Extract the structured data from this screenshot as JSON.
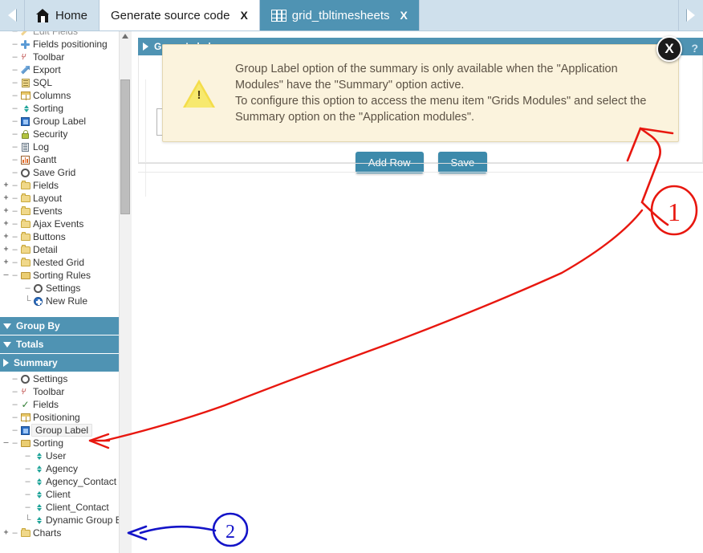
{
  "window": {
    "nav_prev_icon": "chevron-left-icon",
    "nav_next_icon": "chevron-right-icon"
  },
  "tabs": [
    {
      "label": "Home",
      "icon": "home-icon",
      "closable": false,
      "active": false
    },
    {
      "label": "Generate source code",
      "icon": "",
      "close_label": "X",
      "closable": true,
      "active": false
    },
    {
      "label": "grid_tbltimesheets",
      "icon": "grid-icon",
      "close_label": "X",
      "closable": true,
      "active": true
    }
  ],
  "sidebar": {
    "items": [
      {
        "label": "Edit Fields",
        "icon": "edit-icon",
        "indent": 0,
        "expander": "",
        "lead": "–",
        "selected": false,
        "clipped": true
      },
      {
        "label": "Fields positioning",
        "icon": "cross-arrows-icon",
        "indent": 0,
        "expander": "",
        "lead": "–",
        "selected": false
      },
      {
        "label": "Toolbar",
        "icon": "toolbar-icon",
        "indent": 0,
        "expander": "",
        "lead": "–",
        "selected": false
      },
      {
        "label": "Export",
        "icon": "export-icon",
        "indent": 0,
        "expander": "",
        "lead": "–",
        "selected": false
      },
      {
        "label": "SQL",
        "icon": "sql-icon",
        "indent": 0,
        "expander": "",
        "lead": "–",
        "selected": false
      },
      {
        "label": "Columns",
        "icon": "columns-icon",
        "indent": 0,
        "expander": "",
        "lead": "–",
        "selected": false
      },
      {
        "label": "Sorting",
        "icon": "sorting-icon",
        "indent": 0,
        "expander": "",
        "lead": "–",
        "selected": false
      },
      {
        "label": "Group Label",
        "icon": "group-label-icon",
        "indent": 0,
        "expander": "",
        "lead": "–",
        "selected": false
      },
      {
        "label": "Security",
        "icon": "lock-icon",
        "indent": 0,
        "expander": "",
        "lead": "–",
        "selected": false
      },
      {
        "label": "Log",
        "icon": "log-icon",
        "indent": 0,
        "expander": "",
        "lead": "–",
        "selected": false
      },
      {
        "label": "Gantt",
        "icon": "gantt-icon",
        "indent": 0,
        "expander": "",
        "lead": "–",
        "selected": false
      },
      {
        "label": "Save Grid",
        "icon": "gear-icon",
        "indent": 0,
        "expander": "",
        "lead": "–",
        "selected": false
      },
      {
        "label": "Fields",
        "icon": "folder-icon",
        "indent": 0,
        "expander": "+",
        "lead": "–",
        "selected": false
      },
      {
        "label": "Layout",
        "icon": "folder-icon",
        "indent": 0,
        "expander": "+",
        "lead": "–",
        "selected": false
      },
      {
        "label": "Events",
        "icon": "folder-icon",
        "indent": 0,
        "expander": "+",
        "lead": "–",
        "selected": false
      },
      {
        "label": "Ajax Events",
        "icon": "folder-icon",
        "indent": 0,
        "expander": "+",
        "lead": "–",
        "selected": false
      },
      {
        "label": "Buttons",
        "icon": "folder-icon",
        "indent": 0,
        "expander": "+",
        "lead": "–",
        "selected": false
      },
      {
        "label": "Detail",
        "icon": "folder-icon",
        "indent": 0,
        "expander": "+",
        "lead": "–",
        "selected": false
      },
      {
        "label": "Nested Grid",
        "icon": "folder-icon",
        "indent": 0,
        "expander": "+",
        "lead": "–",
        "selected": false
      },
      {
        "label": "Sorting Rules",
        "icon": "folder-open-icon",
        "indent": 0,
        "expander": "–",
        "lead": "–",
        "selected": false
      },
      {
        "label": "Settings",
        "icon": "gear-icon",
        "indent": 1,
        "expander": "",
        "lead": "–",
        "selected": false
      },
      {
        "label": "New Rule",
        "icon": "new-rule-icon",
        "indent": 1,
        "expander": "",
        "lead": "└",
        "selected": false
      }
    ],
    "sections": [
      {
        "label": "Group By",
        "state": "collapsed",
        "caret": "caret-down-icon"
      },
      {
        "label": "Totals",
        "state": "collapsed",
        "caret": "caret-down-icon"
      },
      {
        "label": "Summary",
        "state": "expanded",
        "caret": "caret-right-icon"
      }
    ],
    "summary_items": [
      {
        "label": "Settings",
        "icon": "gear-icon",
        "indent": 0,
        "expander": "",
        "lead": "–",
        "selected": false
      },
      {
        "label": "Toolbar",
        "icon": "toolbar-icon",
        "indent": 0,
        "expander": "",
        "lead": "–",
        "selected": false
      },
      {
        "label": "Fields",
        "icon": "check-icon",
        "indent": 0,
        "expander": "",
        "lead": "–",
        "selected": false
      },
      {
        "label": "Positioning",
        "icon": "columns-icon",
        "indent": 0,
        "expander": "",
        "lead": "–",
        "selected": false
      },
      {
        "label": "Group Label",
        "icon": "group-label-icon",
        "indent": 0,
        "expander": "",
        "lead": "–",
        "selected": true
      },
      {
        "label": "Sorting",
        "icon": "folder-open-icon",
        "indent": 0,
        "expander": "–",
        "lead": "–",
        "selected": false
      },
      {
        "label": "User",
        "icon": "sorting-icon",
        "indent": 1,
        "expander": "",
        "lead": "–",
        "selected": false
      },
      {
        "label": "Agency",
        "icon": "sorting-icon",
        "indent": 1,
        "expander": "",
        "lead": "–",
        "selected": false
      },
      {
        "label": "Agency_Contact",
        "icon": "sorting-icon",
        "indent": 1,
        "expander": "",
        "lead": "–",
        "selected": false
      },
      {
        "label": "Client",
        "icon": "sorting-icon",
        "indent": 1,
        "expander": "",
        "lead": "–",
        "selected": false
      },
      {
        "label": "Client_Contact",
        "icon": "sorting-icon",
        "indent": 1,
        "expander": "",
        "lead": "–",
        "selected": false
      },
      {
        "label": "Dynamic Group By",
        "icon": "sorting-icon",
        "indent": 1,
        "expander": "",
        "lead": "└",
        "selected": false
      },
      {
        "label": "Charts",
        "icon": "folder-icon",
        "indent": 0,
        "expander": "+",
        "lead": "–",
        "selected": false
      }
    ]
  },
  "panel": {
    "title": "Group Label",
    "help_icon": "help-question-icon",
    "buttons": [
      {
        "label": "Add Row",
        "name": "add-row-button"
      },
      {
        "label": "Save",
        "name": "save-button"
      }
    ]
  },
  "tooltip": {
    "icon": "warning-triangle-icon",
    "bang": "!",
    "close_label": "X",
    "text": "Group Label option of the summary is only available when the \"Application Modules\" have the \"Summary\" option active.\nTo configure this option to access the menu item \"Grids Modules\" and select the Summary option on the \"Application modules\"."
  },
  "annotations": [
    {
      "id": "1",
      "label": "1",
      "color": "#e8170f",
      "points_to": "tooltip-bottom-right"
    },
    {
      "id": "2",
      "label": "2",
      "color": "#1414c8",
      "points_to": "dynamic-group-by-row"
    }
  ],
  "colors": {
    "accent": "#4f93b3",
    "tabbar": "#cfe0ec",
    "tooltip_bg": "#fbf3dd",
    "tooltip_border": "#e3d7b2",
    "annotation_red": "#e8170f",
    "annotation_blue": "#1414c8",
    "button": "#3d8aab"
  }
}
